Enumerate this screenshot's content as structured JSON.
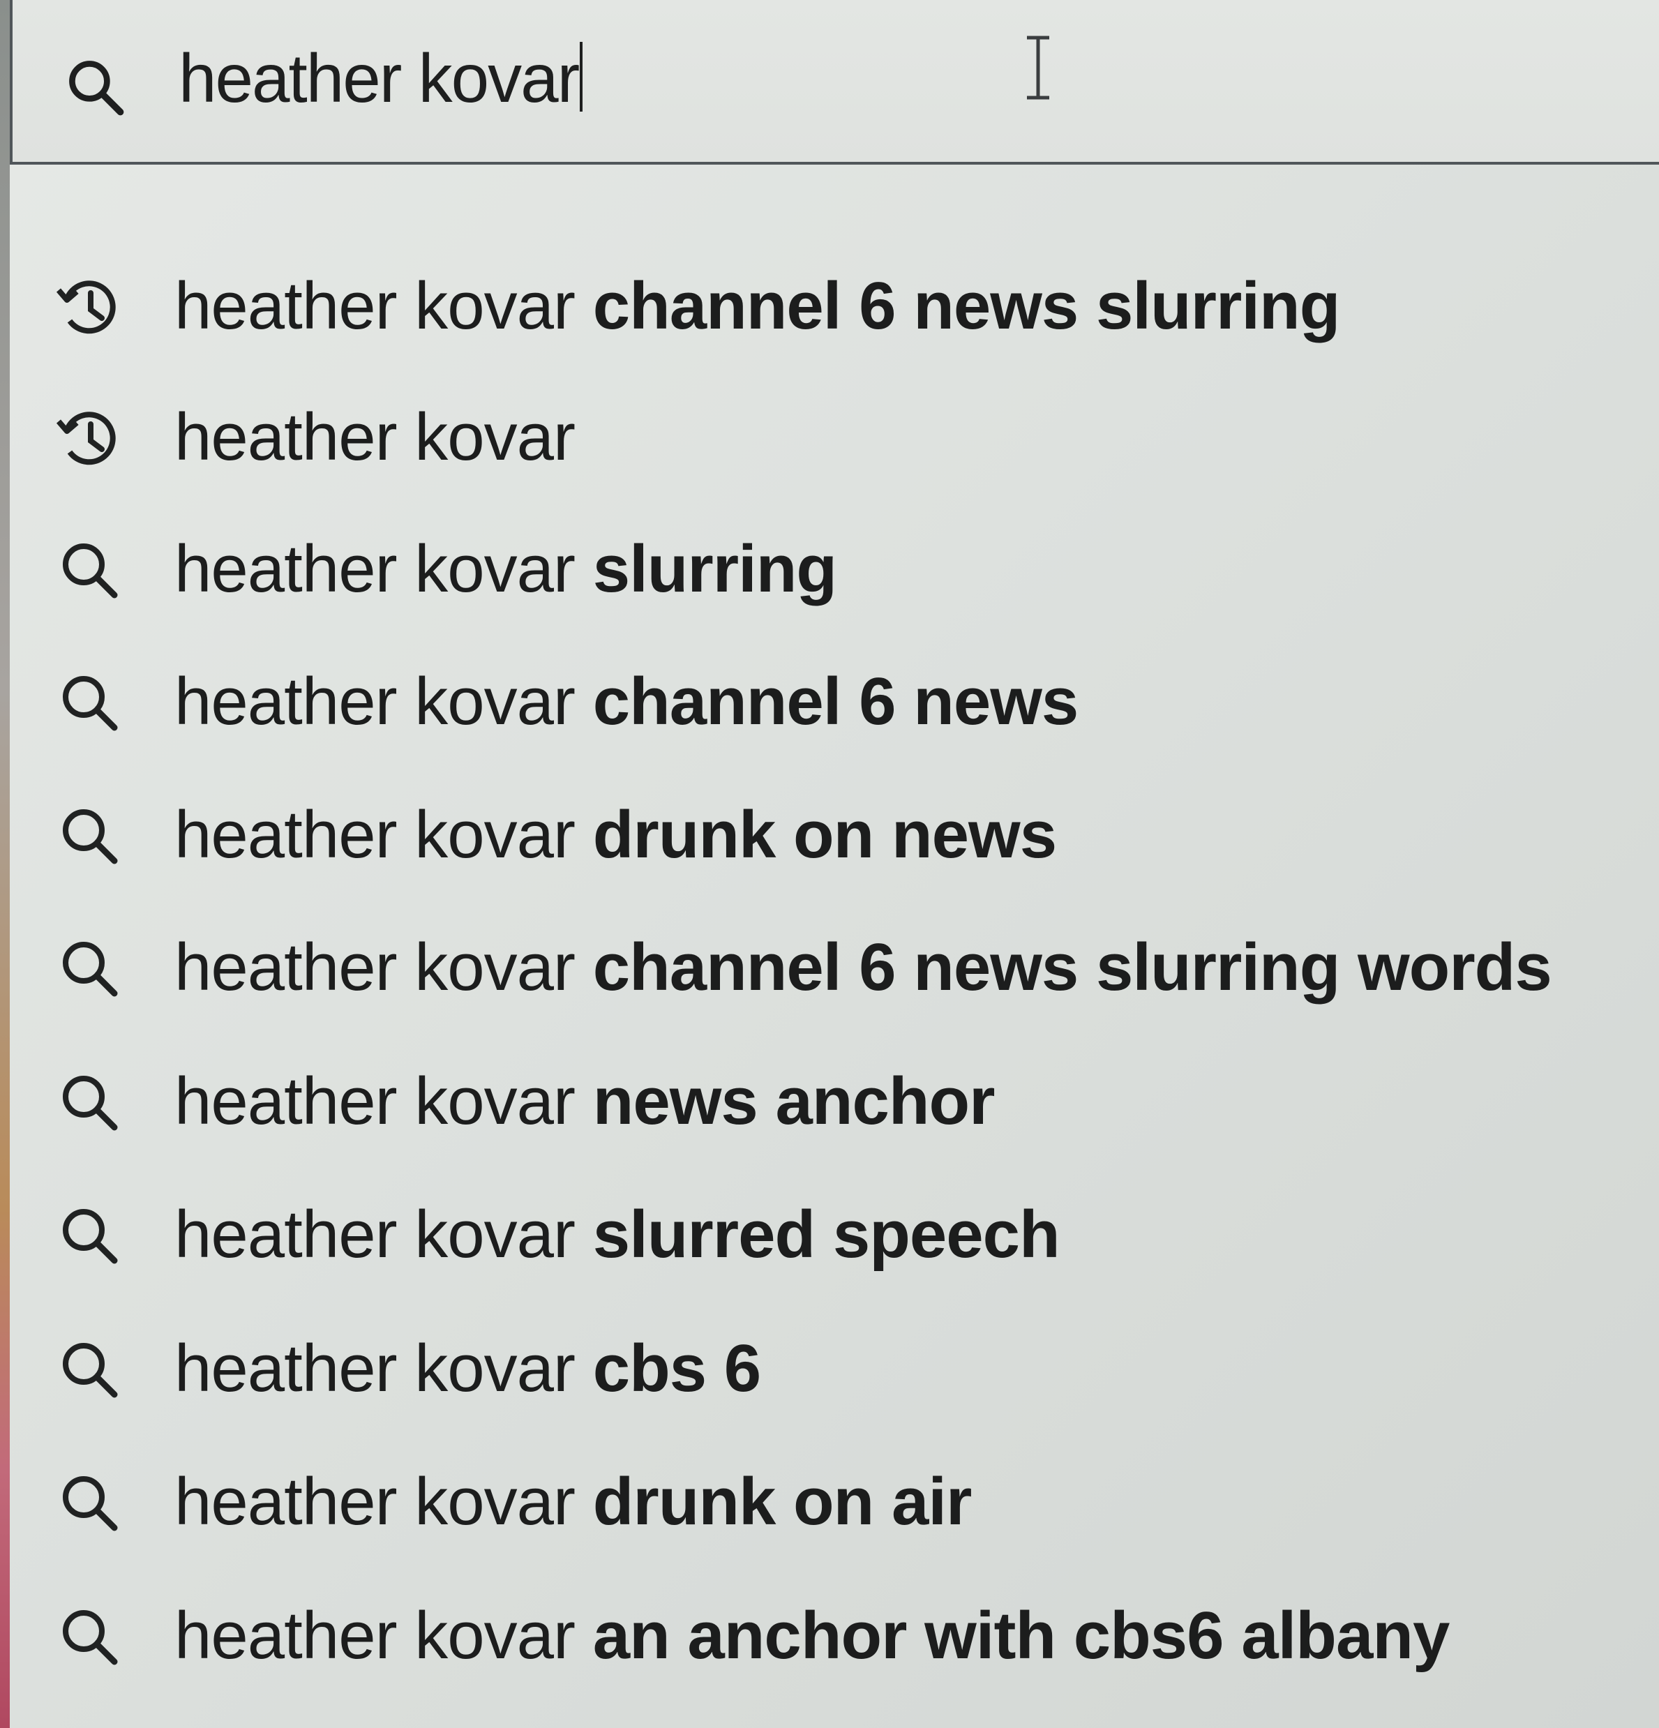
{
  "search": {
    "query": "heather kovar",
    "icon": "search-icon"
  },
  "suggestions": [
    {
      "icon": "history-icon",
      "typed": "heather kovar",
      "rest": " channel 6 news slurring"
    },
    {
      "icon": "history-icon",
      "typed": "heather kovar",
      "rest": ""
    },
    {
      "icon": "search-icon",
      "typed": "heather kovar",
      "rest": " slurring"
    },
    {
      "icon": "search-icon",
      "typed": "heather kovar",
      "rest": " channel 6 news"
    },
    {
      "icon": "search-icon",
      "typed": "heather kovar",
      "rest": " drunk on news"
    },
    {
      "icon": "search-icon",
      "typed": "heather kovar",
      "rest": " channel 6 news slurring words"
    },
    {
      "icon": "search-icon",
      "typed": "heather kovar",
      "rest": " news anchor"
    },
    {
      "icon": "search-icon",
      "typed": "heather kovar",
      "rest": " slurred speech"
    },
    {
      "icon": "search-icon",
      "typed": "heather kovar",
      "rest": " cbs 6"
    },
    {
      "icon": "search-icon",
      "typed": "heather kovar",
      "rest": " drunk on air"
    },
    {
      "icon": "search-icon",
      "typed": "heather kovar",
      "rest": " an anchor with cbs6 albany"
    }
  ]
}
